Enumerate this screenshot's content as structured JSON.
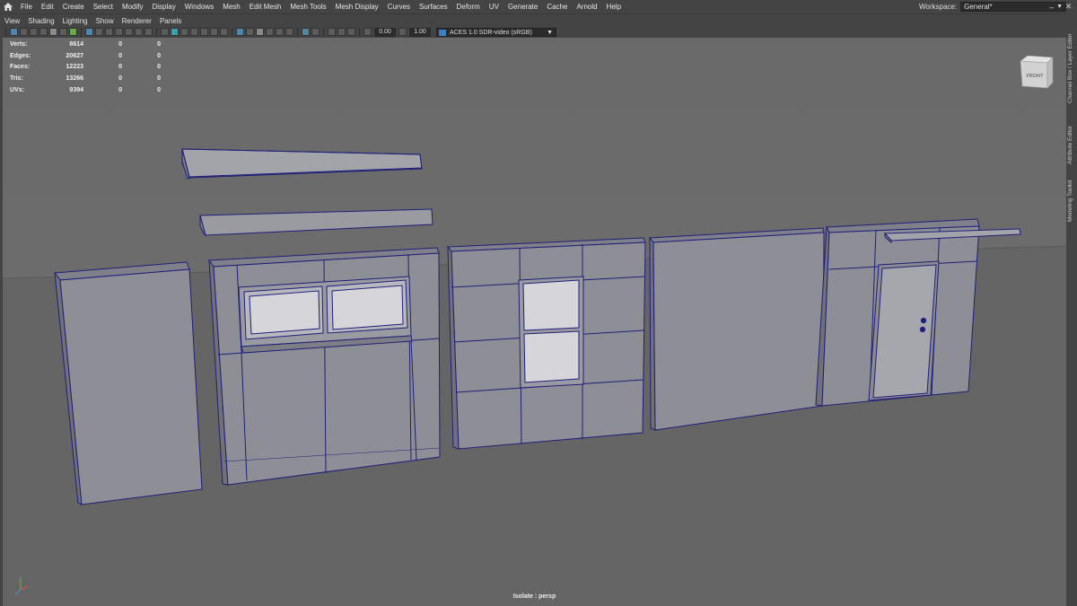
{
  "menubar": {
    "items": [
      "File",
      "Edit",
      "Create",
      "Select",
      "Modify",
      "Display",
      "Windows",
      "Mesh",
      "Edit Mesh",
      "Mesh Tools",
      "Mesh Display",
      "Curves",
      "Surfaces",
      "Deform",
      "UV",
      "Generate",
      "Cache",
      "Arnold",
      "Help"
    ],
    "workspace_label": "Workspace:",
    "workspace_value": "General*"
  },
  "panel_menu": {
    "items": [
      "View",
      "Shading",
      "Lighting",
      "Show",
      "Renderer",
      "Panels"
    ]
  },
  "toolbar": {
    "exposure": "0.00",
    "gamma": "1.00",
    "color_space": "ACES 1.0 SDR-video (sRGB)"
  },
  "hud": {
    "rows": [
      {
        "label": "Verts:",
        "v0": "8614",
        "v1": "0",
        "v2": "0"
      },
      {
        "label": "Edges:",
        "v0": "20627",
        "v1": "0",
        "v2": "0"
      },
      {
        "label": "Faces:",
        "v0": "12223",
        "v1": "0",
        "v2": "0"
      },
      {
        "label": "Tris:",
        "v0": "13266",
        "v1": "0",
        "v2": "0"
      },
      {
        "label": "UVs:",
        "v0": "9394",
        "v1": "0",
        "v2": "0"
      }
    ]
  },
  "viewport": {
    "isolate_label": "Isolate : persp",
    "viewcube_label": "FRONT",
    "background_color": "#6b6b6b",
    "wire_color": "#22237a",
    "mesh_color": "#8e8e96"
  },
  "sidebar": {
    "tabs": [
      "Channel Box / Layer Editor",
      "Attribute Editor",
      "Modeling Toolkit"
    ]
  }
}
